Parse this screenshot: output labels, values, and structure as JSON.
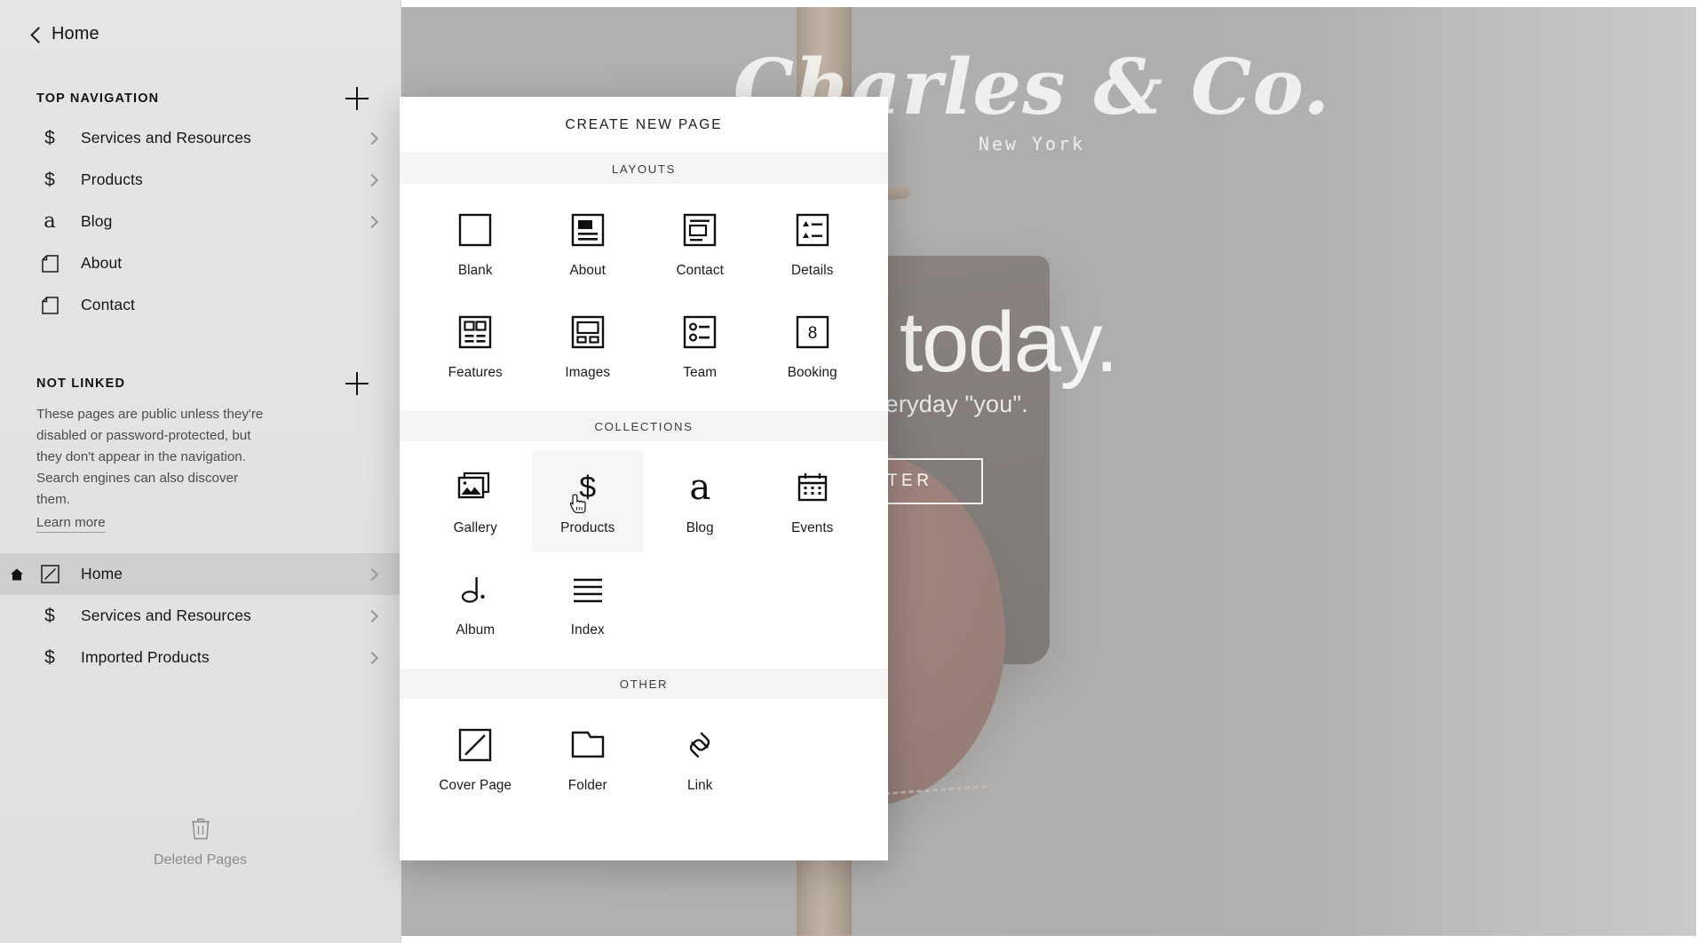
{
  "sidebar": {
    "back": {
      "label": "Home",
      "icon": "chevron-left-icon"
    },
    "sections": [
      {
        "id": "top-navigation",
        "title": "TOP NAVIGATION",
        "add_icon": "plus-icon",
        "items": [
          {
            "label": "Services and Resources",
            "icon": "dollar-icon",
            "chevron": "chevron-right-icon"
          },
          {
            "label": "Products",
            "icon": "dollar-icon",
            "chevron": "chevron-right-icon"
          },
          {
            "label": "Blog",
            "icon": "blog-a-icon",
            "chevron": "chevron-right-icon"
          },
          {
            "label": "About",
            "icon": "page-icon",
            "chevron": ""
          },
          {
            "label": "Contact",
            "icon": "page-icon",
            "chevron": ""
          }
        ]
      },
      {
        "id": "not-linked",
        "title": "NOT LINKED",
        "add_icon": "plus-icon",
        "description": "These pages are public unless they're disabled or password-protected, but they don't appear in the navigation. Search engines can also discover them.",
        "learn_more": "Learn more",
        "items": [
          {
            "label": "Home",
            "icon": "cover-page-icon",
            "chevron": "chevron-right-icon",
            "active": true,
            "home_flag": "home-icon"
          },
          {
            "label": "Services and Resources",
            "icon": "dollar-icon",
            "chevron": "chevron-right-icon"
          },
          {
            "label": "Imported Products",
            "icon": "dollar-icon",
            "chevron": "chevron-right-icon"
          }
        ]
      }
    ],
    "deleted": {
      "label": "Deleted Pages",
      "icon": "trash-icon"
    }
  },
  "modal": {
    "title": "CREATE NEW PAGE",
    "groups": [
      {
        "id": "layouts",
        "heading": "LAYOUTS",
        "tiles": [
          {
            "label": "Blank",
            "icon": "blank-layout-icon"
          },
          {
            "label": "About",
            "icon": "about-layout-icon"
          },
          {
            "label": "Contact",
            "icon": "contact-layout-icon"
          },
          {
            "label": "Details",
            "icon": "details-layout-icon"
          },
          {
            "label": "Features",
            "icon": "features-layout-icon"
          },
          {
            "label": "Images",
            "icon": "images-layout-icon"
          },
          {
            "label": "Team",
            "icon": "team-layout-icon"
          },
          {
            "label": "Booking",
            "icon": "booking-layout-icon",
            "badge": "8"
          }
        ]
      },
      {
        "id": "collections",
        "heading": "COLLECTIONS",
        "tiles": [
          {
            "label": "Gallery",
            "icon": "gallery-icon"
          },
          {
            "label": "Products",
            "icon": "dollar-icon",
            "hovered": true,
            "cursor": "pointer-cursor"
          },
          {
            "label": "Blog",
            "icon": "blog-a-icon"
          },
          {
            "label": "Events",
            "icon": "calendar-icon"
          },
          {
            "label": "Album",
            "icon": "music-note-icon"
          },
          {
            "label": "Index",
            "icon": "index-lines-icon"
          }
        ]
      },
      {
        "id": "other",
        "heading": "OTHER",
        "tiles": [
          {
            "label": "Cover Page",
            "icon": "cover-page-icon"
          },
          {
            "label": "Folder",
            "icon": "folder-icon"
          },
          {
            "label": "Link",
            "icon": "link-icon"
          }
        ]
      }
    ]
  },
  "preview": {
    "brand_name": "Charles & Co.",
    "brand_sub": "New York",
    "headline": "ur look today.",
    "subhead": "Bags for the everyday \"you\".",
    "enter_label": "ENTER"
  },
  "colors": {
    "sidebar_bg": "#e4e4e4",
    "sidebar_active": "#cfcfcf",
    "modal_bg": "#ffffff",
    "group_head_bg": "#f5f5f5",
    "tile_hover_bg": "#f6f6f6",
    "text_primary": "#161616",
    "text_muted": "#8b8b8b",
    "preview_bg": "#b3b1b0"
  }
}
